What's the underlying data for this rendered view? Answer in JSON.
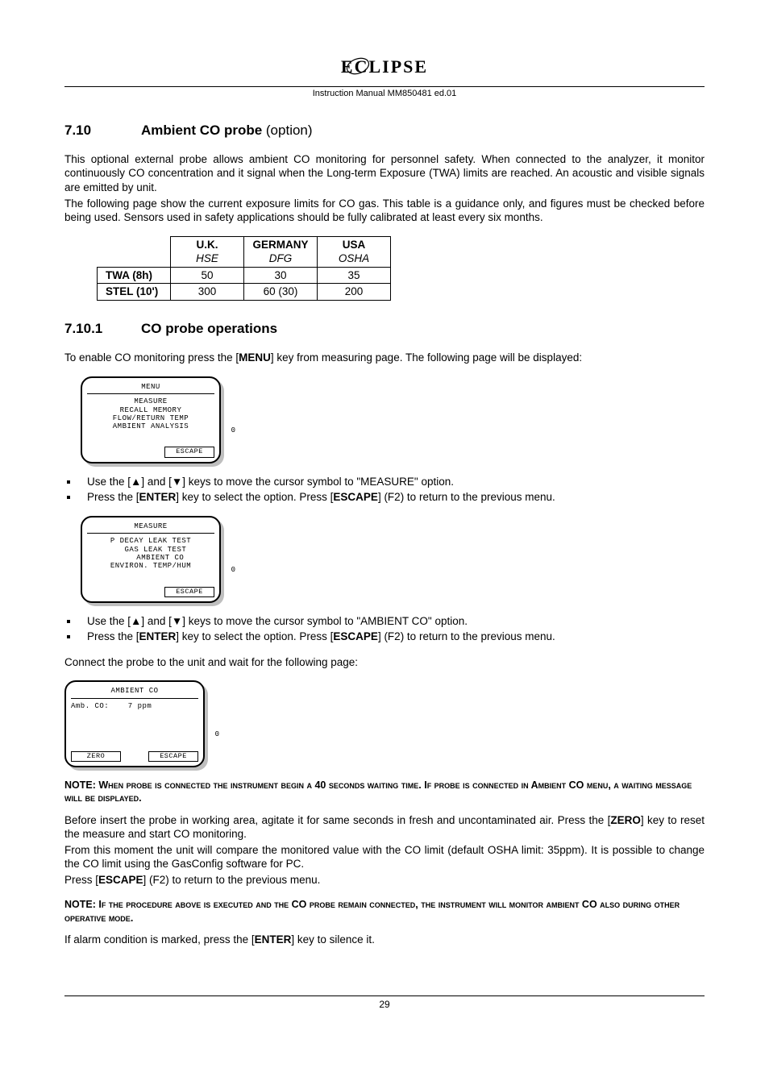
{
  "header": {
    "logo_text": "ECLIPSE",
    "manual": "Instruction Manual MM850481 ed.01"
  },
  "sec710": {
    "num": "7.10",
    "title": "Ambient CO probe",
    "title_suffix": " (option)",
    "p1": "This optional external probe allows ambient CO monitoring for personnel safety. When connected to the analyzer, it monitor continuously CO concentration and it signal when the Long-term Exposure (TWA) limits are reached. An acoustic and visible signals are emitted by unit.",
    "p2": "The following page show the current exposure limits for CO gas. This table is a guidance only, and figures must be checked before being used. Sensors used in safety applications should be fully calibrated at least every six months."
  },
  "limits_table": {
    "headers": [
      {
        "top": "U.K.",
        "sub": "HSE"
      },
      {
        "top": "GERMANY",
        "sub": "DFG"
      },
      {
        "top": "USA",
        "sub": "OSHA"
      }
    ],
    "rows": [
      {
        "label": "TWA (8h)",
        "vals": [
          "50",
          "30",
          "35"
        ]
      },
      {
        "label": "STEL (10')",
        "vals": [
          "300",
          "60 (30)",
          "200"
        ]
      }
    ]
  },
  "sec7101": {
    "num": "7.10.1",
    "title": "CO probe operations",
    "intro_a": "To enable CO monitoring press the [",
    "intro_key": "MENU",
    "intro_b": "] key from measuring page. The following page will be displayed:"
  },
  "lcd1": {
    "title": "MENU",
    "body": "MEASURE\nRECALL MEMORY\nFLOW/RETURN TEMP\nAMBIENT ANALYSIS",
    "soft_left": "",
    "soft_right": "ESCAPE"
  },
  "bullets1": {
    "b1_a": "Use the [▲] and [▼] keys to move the cursor symbol to \"MEASURE\" option.",
    "b2_a": "Press the [",
    "b2_k1": "ENTER",
    "b2_b": "] key to select the option. Press [",
    "b2_k2": "ESCAPE",
    "b2_c": "] (F2) to return to the previous menu."
  },
  "lcd2": {
    "title": "MEASURE",
    "body": "P DECAY LEAK TEST\n  GAS LEAK TEST\n    AMBIENT CO\nENVIRON. TEMP/HUM",
    "soft_left": "",
    "soft_right": "ESCAPE"
  },
  "bullets2": {
    "b1_a": "Use the [▲] and [▼] keys to move the cursor symbol to \"AMBIENT CO\" option.",
    "b2_a": "Press the [",
    "b2_k1": "ENTER",
    "b2_b": "] key to select the option. Press [",
    "b2_k2": "ESCAPE",
    "b2_c": "] (F2) to return to the previous menu."
  },
  "connect_line": "Connect the probe to the unit and wait for the following page:",
  "lcd3": {
    "title": "AMBIENT CO",
    "body": "Amb. CO:    7 ppm",
    "soft_left": "ZERO",
    "soft_right": "ESCAPE"
  },
  "note1": {
    "lead": "NOTE: ",
    "text_a": "When probe is connected the instrument begin a 40 seconds waiting time. If probe is connected in Ambient CO menu, a waiting message will be displayed."
  },
  "after": {
    "p1_a": "Before insert the probe in working area, agitate it for same seconds in fresh and uncontaminated air. Press the [",
    "p1_k": "ZERO",
    "p1_b": "] key to reset the measure and start CO monitoring.",
    "p2": "From this moment the unit will compare the monitored value with the CO limit (default OSHA limit: 35ppm). It is possible to change the CO limit using the GasConfig software for PC.",
    "p3_a": "Press [",
    "p3_k": "ESCAPE",
    "p3_b": "] (F2) to return to the previous menu."
  },
  "note2": {
    "lead": "NOTE: ",
    "text_a": "If the procedure above is executed and the CO probe remain connected, the instrument will monitor ambient CO also during other operative mode."
  },
  "last": {
    "a": "If alarm condition is marked, press the [",
    "k": "ENTER",
    "b": "] key to silence it."
  },
  "footer": {
    "page": "29"
  }
}
